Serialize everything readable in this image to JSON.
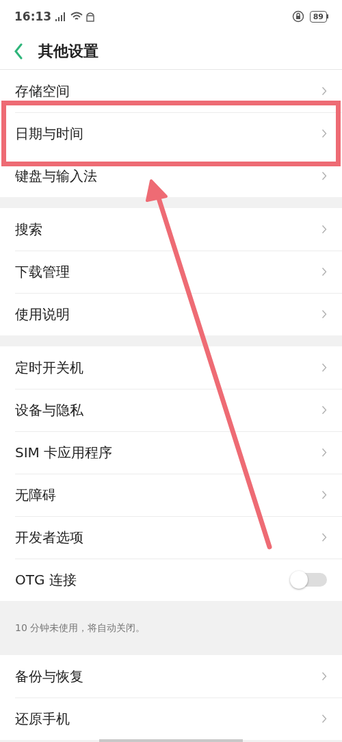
{
  "status_bar": {
    "time": "16:13",
    "battery": "89"
  },
  "header": {
    "title": "其他设置"
  },
  "groups": [
    {
      "items": [
        {
          "kind": "link",
          "label": "存储空间",
          "highlighted": false
        },
        {
          "kind": "link",
          "label": "日期与时间",
          "highlighted": true
        },
        {
          "kind": "link",
          "label": "键盘与输入法",
          "highlighted": false
        }
      ]
    },
    {
      "items": [
        {
          "kind": "link",
          "label": "搜索",
          "highlighted": false
        },
        {
          "kind": "link",
          "label": "下载管理",
          "highlighted": false
        },
        {
          "kind": "link",
          "label": "使用说明",
          "highlighted": false
        }
      ]
    },
    {
      "items": [
        {
          "kind": "link",
          "label": "定时开关机",
          "highlighted": false
        },
        {
          "kind": "link",
          "label": "设备与隐私",
          "highlighted": false
        },
        {
          "kind": "link",
          "label": "SIM 卡应用程序",
          "highlighted": false
        },
        {
          "kind": "link",
          "label": "无障碍",
          "highlighted": false
        },
        {
          "kind": "link",
          "label": "开发者选项",
          "highlighted": false
        },
        {
          "kind": "toggle",
          "label": "OTG 连接",
          "on": false,
          "highlighted": false
        }
      ],
      "note": "10 分钟未使用，将自动关闭。"
    },
    {
      "items": [
        {
          "kind": "link",
          "label": "备份与恢复",
          "highlighted": false
        },
        {
          "kind": "link",
          "label": "还原手机",
          "highlighted": false
        }
      ]
    }
  ]
}
